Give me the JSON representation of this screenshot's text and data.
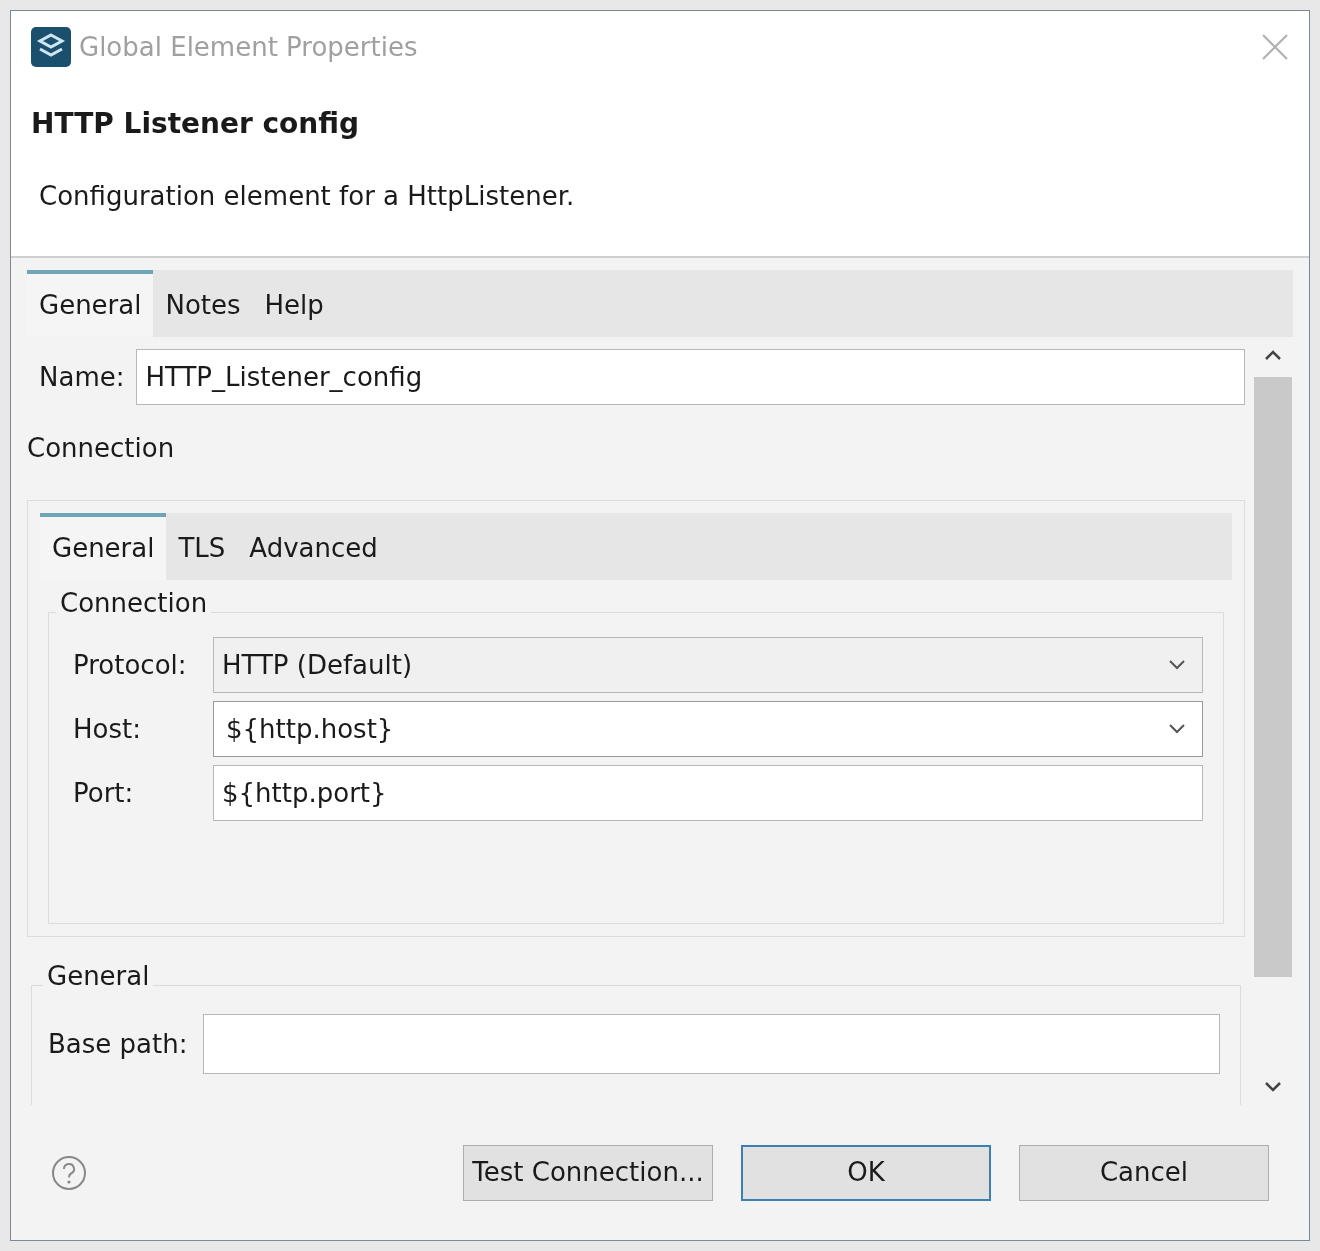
{
  "window": {
    "title": "Global Element Properties"
  },
  "header": {
    "title": "HTTP Listener config",
    "description": "Configuration element for a HttpListener."
  },
  "tabs": [
    {
      "label": "General",
      "selected": true
    },
    {
      "label": "Notes",
      "selected": false
    },
    {
      "label": "Help",
      "selected": false
    }
  ],
  "name_field": {
    "label": "Name:",
    "value": "HTTP_Listener_config"
  },
  "connection_section": {
    "label": "Connection",
    "tabs": [
      {
        "label": "General",
        "selected": true
      },
      {
        "label": "TLS",
        "selected": false
      },
      {
        "label": "Advanced",
        "selected": false
      }
    ],
    "group": {
      "label": "Connection",
      "fields": [
        {
          "label": "Protocol:",
          "value": "HTTP (Default)",
          "kind": "select"
        },
        {
          "label": "Host:",
          "value": "${http.host}",
          "kind": "combo"
        },
        {
          "label": "Port:",
          "value": "${http.port}",
          "kind": "text"
        }
      ]
    }
  },
  "general_group": {
    "label": "General",
    "fields": [
      {
        "label": "Base path:",
        "kind": "text"
      }
    ]
  },
  "buttons": [
    {
      "label": "Test Connection...",
      "default": false
    },
    {
      "label": "OK",
      "default": true
    },
    {
      "label": "Cancel",
      "default": false
    }
  ]
}
